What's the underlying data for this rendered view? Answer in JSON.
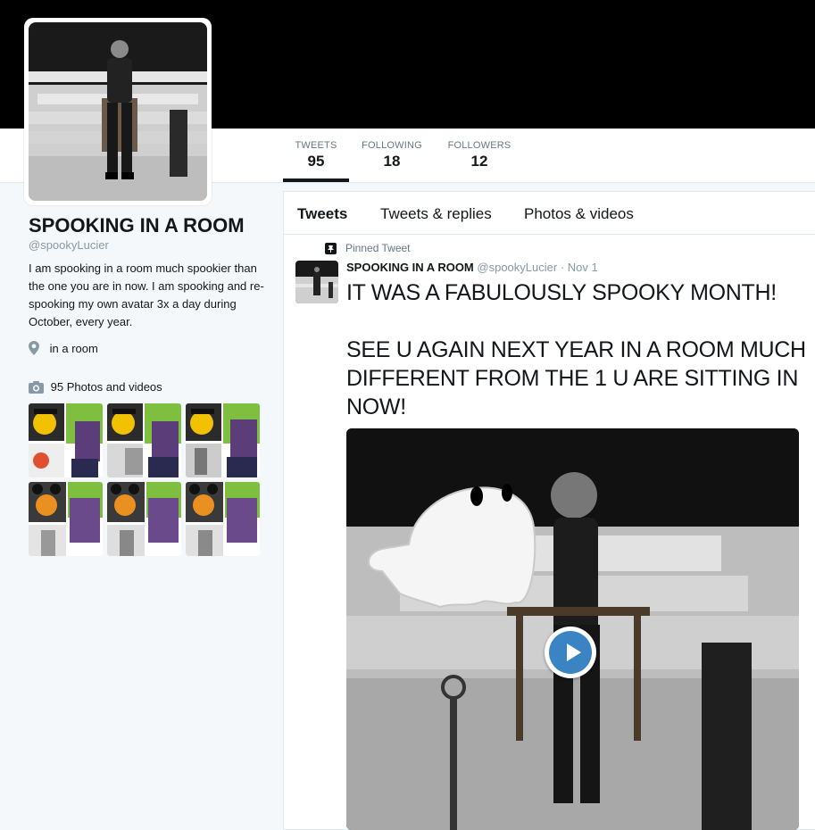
{
  "profile": {
    "name": "SPOOKING IN A ROOM",
    "handle": "@spookyLucier",
    "bio": "I am spooking in a room much spookier than the one you are in now. I am spooking and re-spooking my own avatar 3x a day during October, every year.",
    "location": "in a room",
    "photos_label": "95 Photos and videos"
  },
  "stats": [
    {
      "label": "TWEETS",
      "value": "95"
    },
    {
      "label": "FOLLOWING",
      "value": "18"
    },
    {
      "label": "FOLLOWERS",
      "value": "12"
    }
  ],
  "tabs": [
    {
      "label": "Tweets"
    },
    {
      "label": "Tweets & replies"
    },
    {
      "label": "Photos & videos"
    }
  ],
  "pinned": {
    "label": "Pinned Tweet",
    "author_name": "SPOOKING IN A ROOM",
    "author_handle": "@spookyLucier",
    "separator": "·",
    "date": "Nov 1",
    "text": "IT WAS A FABULOUSLY SPOOKY MONTH!\n\nSEE U AGAIN NEXT YEAR IN A ROOM MUCH DIFFERENT FROM THE 1 U ARE SITTING IN NOW!"
  },
  "icons": {
    "location": "map-pin-icon",
    "camera": "camera-icon",
    "pin": "pinned-icon",
    "play": "play-icon"
  },
  "colors": {
    "header": "#000000",
    "play": "#3b84c4",
    "muted": "#8899a6"
  }
}
